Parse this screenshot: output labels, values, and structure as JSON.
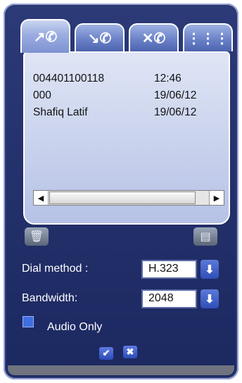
{
  "tabs": [
    {
      "icon": "outgoing-call-icon",
      "glyph": "↗✆",
      "active": true
    },
    {
      "icon": "incoming-call-icon",
      "glyph": "↘✆",
      "active": false
    },
    {
      "icon": "missed-call-icon",
      "glyph": "✕✆",
      "active": false
    },
    {
      "icon": "keypad-icon",
      "glyph": "⋮⋮⋮",
      "active": false
    }
  ],
  "call_list": [
    {
      "number": "004401100118",
      "time": "12:46"
    },
    {
      "number": "000",
      "time": "19/06/12"
    },
    {
      "number": "Shafiq Latif",
      "time": "19/06/12"
    }
  ],
  "scrollbar": {
    "left_glyph": "◀",
    "right_glyph": "▶"
  },
  "actions": {
    "delete_glyph": "🗑",
    "phonebook_glyph": "▤"
  },
  "dial_method": {
    "label": "Dial method :",
    "value": "H.323",
    "arrow": "⬇"
  },
  "bandwidth": {
    "label": "Bandwidth:",
    "value": "2048",
    "arrow": "⬇"
  },
  "audio_only": {
    "label": "Audio Only",
    "checked": false
  },
  "footer": {
    "confirm_glyph": "✔",
    "cancel_glyph": "✖"
  }
}
